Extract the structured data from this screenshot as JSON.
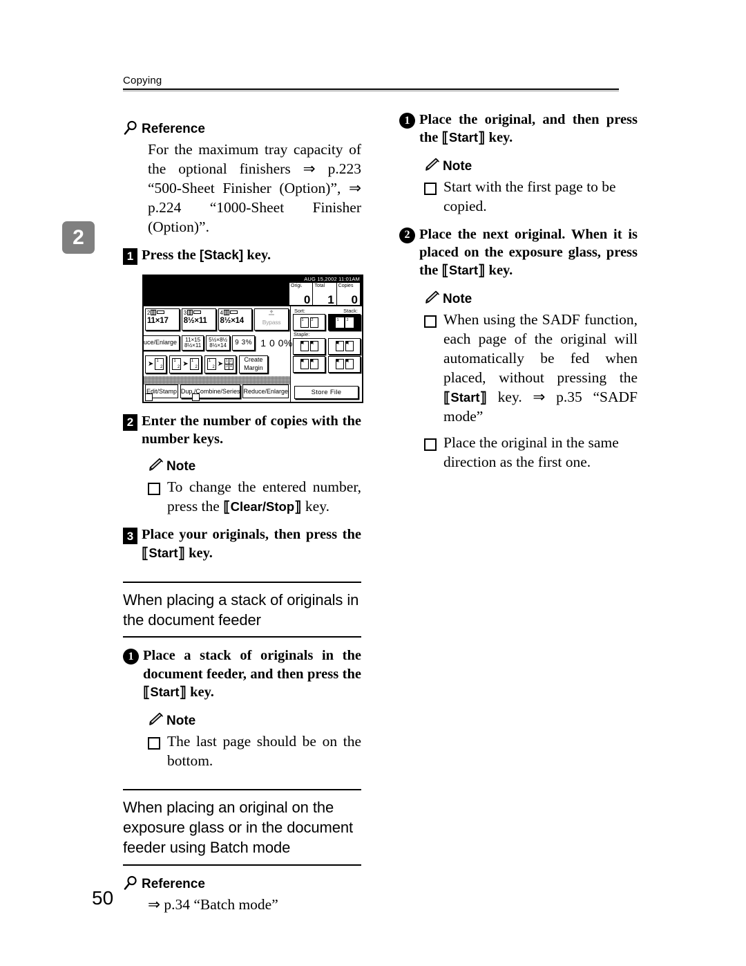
{
  "page": {
    "running_head": "Copying",
    "chapter_tab": "2",
    "folio": "50"
  },
  "left_column": {
    "reference_heading": "Reference",
    "reference_body": "For the maximum tray capacity of the optional finishers ⇒ p.223 “500-Sheet Finisher (Option)”, ⇒ p.224 “1000-Sheet Finisher (Option)”.",
    "step1": {
      "marker": "1",
      "text_before": "Press the [Stack] key.",
      "key": "[Stack]"
    },
    "step1_text_a": "Press the ",
    "step1_text_b": " key.",
    "step2": {
      "marker": "2",
      "text": "Enter the number of copies with the number keys."
    },
    "step2_note_heading": "Note",
    "step2_note_a": "To change the entered number, press the ",
    "step2_note_key": "Clear/Stop",
    "step2_note_b": " key.",
    "step3": {
      "marker": "3",
      "text_a": "Place your originals, then press the ",
      "key": "Start",
      "text_b": " key."
    },
    "section1_title": "When placing a stack of originals in the document feeder",
    "section1_step1_marker": "1",
    "section1_step1_a": "Place a stack of originals in the document feeder, and then press the ",
    "section1_step1_key": "Start",
    "section1_step1_b": " key.",
    "section1_note_heading": "Note",
    "section1_note_item": "The last page should be on the bottom.",
    "section2_title": "When placing an original on the exposure glass or in the document feeder using Batch mode",
    "section2_reference_heading": "Reference",
    "section2_reference_body": "⇒ p.34 “Batch mode”"
  },
  "right_column": {
    "step1_marker": "1",
    "step1_a": "Place the original, and then press the ",
    "step1_key": "Start",
    "step1_b": " key.",
    "note1_heading": "Note",
    "note1_item": "Start with the first page to be copied.",
    "step2_marker": "2",
    "step2_a": "Place the next original. When it is placed on the exposure glass, press the ",
    "step2_key": "Start",
    "step2_b": " key.",
    "note2_heading": "Note",
    "note2_item1_a": "When using the SADF function, each page of the original will automatically be fed when placed, without pressing the ",
    "note2_item1_key": "Start",
    "note2_item1_b": " key. ⇒ p.35 “SADF mode”",
    "note2_item2": "Place the original in the same direction as the first one."
  },
  "lcd": {
    "date": "AUG  15,2002 11:01AM",
    "counters": [
      {
        "label": "Origi.",
        "value": "0"
      },
      {
        "label": "Total",
        "value": "1"
      },
      {
        "label": "Copies",
        "value": "0"
      }
    ],
    "trays": [
      {
        "num": "2",
        "size": "11×17"
      },
      {
        "num": "3",
        "size": "8½×11"
      },
      {
        "num": "4",
        "size": "8½×14"
      }
    ],
    "bypass_label": "Bypass",
    "ratio_row": {
      "reduce_enlarge_label": "uce/Enlarge",
      "preset1_top": "11×15",
      "preset1_bot": "8½×11",
      "preset2_top": "5½×8½",
      "preset2_bot": "8½×14",
      "preset3": "9 3%",
      "current": "1 0 0%"
    },
    "duplex_row": {
      "create_margin_line1": "Create",
      "create_margin_line2": "Margin"
    },
    "tabs": [
      {
        "label": "Edit/Stamp",
        "selected": false
      },
      {
        "label": "Dup./Combine/Series",
        "selected": true
      },
      {
        "label": "Reduce/Enlarge",
        "selected": false
      }
    ],
    "side": {
      "sort_label": "Sort:",
      "stack_label": "Stack:",
      "staple_label": "Staple:",
      "store_file_label": "Store File",
      "selected_finisher": "Stack"
    }
  }
}
